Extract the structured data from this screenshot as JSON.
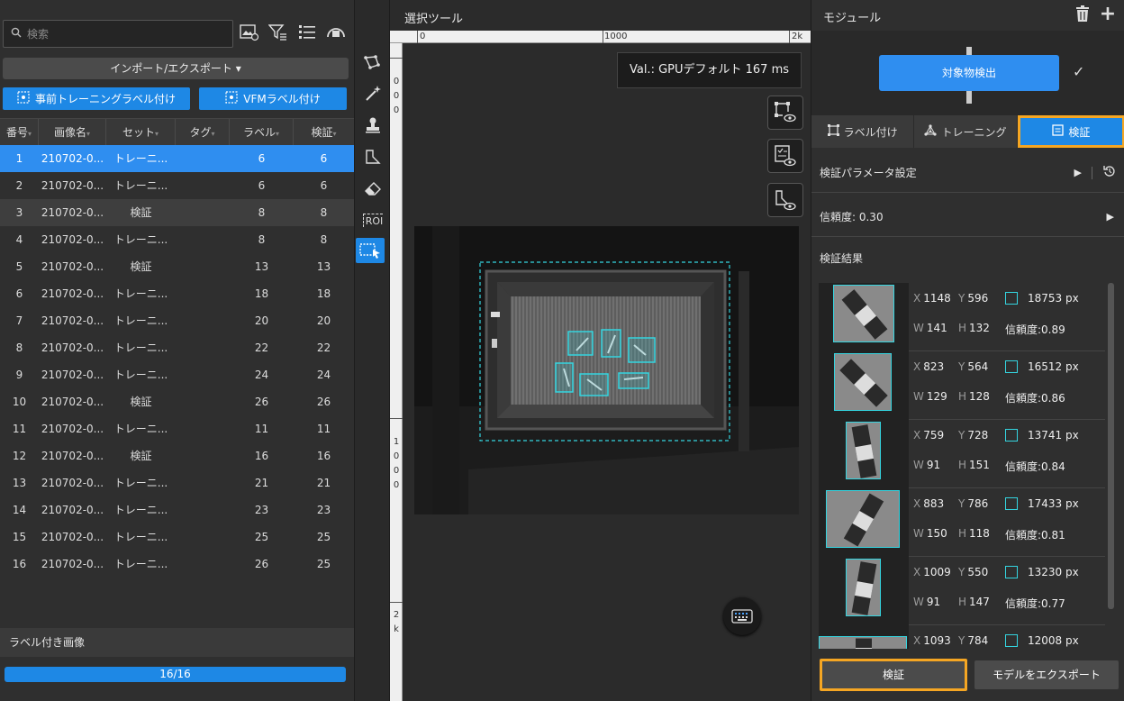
{
  "left": {
    "search_placeholder": "検索",
    "import_export_label": "インポート/エクスポート ▾",
    "pretrain_label_btn": "事前トレーニングラベル付け",
    "vfm_label_btn": "VFMラベル付け",
    "columns": [
      "番号",
      "画像名",
      "セット",
      "タグ",
      "ラベル",
      "検証"
    ],
    "rows": [
      {
        "num": "1",
        "name": "210702-0...",
        "set": "トレーニ...",
        "tag": "",
        "label": "6",
        "val": "6"
      },
      {
        "num": "2",
        "name": "210702-0...",
        "set": "トレーニ...",
        "tag": "",
        "label": "6",
        "val": "6"
      },
      {
        "num": "3",
        "name": "210702-0...",
        "set": "検証",
        "tag": "",
        "label": "8",
        "val": "8"
      },
      {
        "num": "4",
        "name": "210702-0...",
        "set": "トレーニ...",
        "tag": "",
        "label": "8",
        "val": "8"
      },
      {
        "num": "5",
        "name": "210702-0...",
        "set": "検証",
        "tag": "",
        "label": "13",
        "val": "13"
      },
      {
        "num": "6",
        "name": "210702-0...",
        "set": "トレーニ...",
        "tag": "",
        "label": "18",
        "val": "18"
      },
      {
        "num": "7",
        "name": "210702-0...",
        "set": "トレーニ...",
        "tag": "",
        "label": "20",
        "val": "20"
      },
      {
        "num": "8",
        "name": "210702-0...",
        "set": "トレーニ...",
        "tag": "",
        "label": "22",
        "val": "22"
      },
      {
        "num": "9",
        "name": "210702-0...",
        "set": "トレーニ...",
        "tag": "",
        "label": "24",
        "val": "24"
      },
      {
        "num": "10",
        "name": "210702-0...",
        "set": "検証",
        "tag": "",
        "label": "26",
        "val": "26"
      },
      {
        "num": "11",
        "name": "210702-0...",
        "set": "トレーニ...",
        "tag": "",
        "label": "11",
        "val": "11"
      },
      {
        "num": "12",
        "name": "210702-0...",
        "set": "検証",
        "tag": "",
        "label": "16",
        "val": "16"
      },
      {
        "num": "13",
        "name": "210702-0...",
        "set": "トレーニ...",
        "tag": "",
        "label": "21",
        "val": "21"
      },
      {
        "num": "14",
        "name": "210702-0...",
        "set": "トレーニ...",
        "tag": "",
        "label": "23",
        "val": "23"
      },
      {
        "num": "15",
        "name": "210702-0...",
        "set": "トレーニ...",
        "tag": "",
        "label": "25",
        "val": "25"
      },
      {
        "num": "16",
        "name": "210702-0...",
        "set": "トレーニ...",
        "tag": "",
        "label": "26",
        "val": "25"
      }
    ],
    "labeled_images_title": "ラベル付き画像",
    "progress_text": "16/16",
    "progress_fraction": 1.0
  },
  "tools": {
    "roi_label": "ROI"
  },
  "canvas": {
    "title": "選択ツール",
    "ruler_top": [
      "0",
      "1000",
      "2k"
    ],
    "ruler_left_0": "0",
    "ruler_left_1": "0",
    "ruler_left_2": "0",
    "ruler_left_1k_a": "1",
    "ruler_left_1k_b": "0",
    "ruler_left_1k_c": "0",
    "ruler_left_1k_d": "0",
    "ruler_left_2k_a": "2",
    "ruler_left_2k_b": "k",
    "val_text": "Val.: GPUデフォルト 167 ms"
  },
  "right": {
    "title": "モジュール",
    "module_name": "対象物検出",
    "tabs": [
      "ラベル付け",
      "トレーニング",
      "検証"
    ],
    "val_params": "検証パラメータ設定",
    "confidence": "信頼度: 0.30",
    "results_title": "検証結果",
    "results": [
      {
        "x": "1148",
        "y": "596",
        "w": "141",
        "h": "132",
        "area": "18753 px",
        "conf": "信頼度:0.89"
      },
      {
        "x": "823",
        "y": "564",
        "w": "129",
        "h": "128",
        "area": "16512 px",
        "conf": "信頼度:0.86"
      },
      {
        "x": "759",
        "y": "728",
        "w": "91",
        "h": "151",
        "area": "13741 px",
        "conf": "信頼度:0.84"
      },
      {
        "x": "883",
        "y": "786",
        "w": "150",
        "h": "118",
        "area": "17433 px",
        "conf": "信頼度:0.81"
      },
      {
        "x": "1009",
        "y": "550",
        "w": "91",
        "h": "147",
        "area": "13230 px",
        "conf": "信頼度:0.77"
      },
      {
        "x": "1093",
        "y": "784",
        "w": "",
        "h": "",
        "area": "12008 px",
        "conf": ""
      }
    ],
    "validate_btn": "検証",
    "export_btn": "モデルをエクスポート"
  },
  "colors": {
    "accent": "#1e88e5",
    "highlight": "#f5a623",
    "detect_box": "#34d5e0"
  }
}
